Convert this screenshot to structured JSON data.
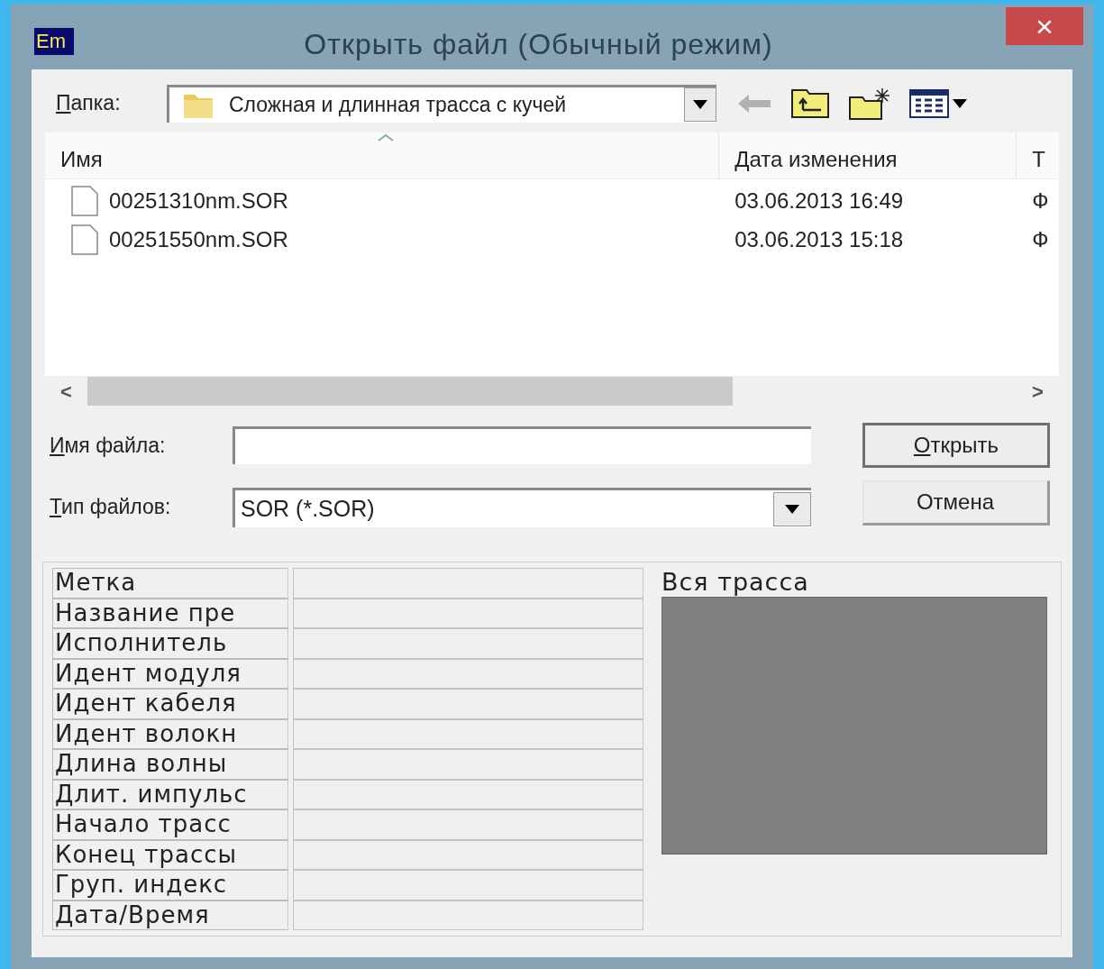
{
  "window": {
    "title": "Открыть файл (Обычный режим)",
    "app_icon": "Em",
    "close": "×"
  },
  "folder": {
    "label": "Папка:",
    "mnemonic": true,
    "value": "Сложная и длинная трасса с кучей"
  },
  "file_list": {
    "columns": [
      {
        "label": "Имя",
        "sorted": true
      },
      {
        "label": "Дата изменения",
        "sorted": false
      },
      {
        "label": "Т",
        "sorted": false
      }
    ],
    "rows": [
      {
        "cells": [
          "00251310nm.SOR",
          "03.06.2013 16:49",
          "Ф"
        ]
      },
      {
        "cells": [
          "00251550nm.SOR",
          "03.06.2013 15:18",
          "Ф"
        ]
      }
    ]
  },
  "file_name": {
    "label": "Имя файла:",
    "mnemonic": true
  },
  "file_type": {
    "label": "Тип файлов:",
    "mnemonic": true,
    "value": "SOR (*.SOR)"
  },
  "buttons": [
    {
      "label": "Открыть",
      "mnemonic": true,
      "default": true
    },
    {
      "label": "Отмена",
      "mnemonic": false,
      "default": false
    }
  ],
  "properties": [
    "Метка",
    "Название пре",
    "Исполнитель",
    "Идент модуля",
    "Идент кабеля",
    "Идент волокн",
    "Длина волны",
    "Длит. импульс",
    "Начало трасс",
    "Конец трассы",
    "Груп. индекс",
    "Дата/Время"
  ],
  "scrollbar": {
    "left": "<",
    "right": ">"
  },
  "preview": {
    "label": "Вся трасса"
  }
}
